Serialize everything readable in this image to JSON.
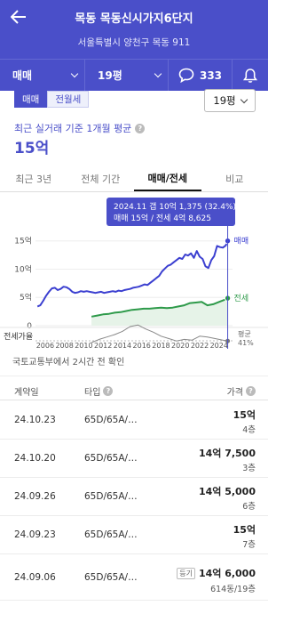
{
  "header": {
    "title": "목동 목동신시가지6단지",
    "address": "서울특별시 양천구 목동 911",
    "filter_type": "매매",
    "filter_size": "19평",
    "comment_count": "333"
  },
  "deal_tabs": [
    "매매",
    "전월세"
  ],
  "size_select": "19평",
  "average": {
    "label": "최근 실거래 기준 1개월 평균",
    "value": "15억"
  },
  "period_tabs": [
    "최근 3년",
    "전체 기간",
    "매매/전세",
    "비교"
  ],
  "chart_data": {
    "type": "line",
    "tooltip": {
      "line1": "2024.11  갭 10억 1,375 (32.4%)",
      "line2": "매매 15억 / 전세 4억 8,625"
    },
    "y_ticks": [
      "15억",
      "10억",
      "5억",
      "0"
    ],
    "ylim": [
      0,
      17
    ],
    "x_ticks": [
      "2006",
      "2008",
      "2010",
      "2012",
      "2014",
      "2016",
      "2018",
      "2020",
      "2022",
      "2024"
    ],
    "xlim": [
      2005.0,
      2025.4
    ],
    "ratio_axis_label": "전세가율",
    "ratio_end_label": "평균",
    "ratio_end_value": "41%",
    "series": [
      {
        "name": "매매",
        "color": "#3b3fd0",
        "x": [
          2005.2,
          2005.5,
          2005.8,
          2006.1,
          2006.4,
          2006.7,
          2007.0,
          2007.3,
          2007.6,
          2007.9,
          2008.2,
          2008.5,
          2008.8,
          2009.1,
          2009.4,
          2009.7,
          2010.0,
          2010.3,
          2010.6,
          2010.9,
          2011.2,
          2011.5,
          2011.8,
          2012.1,
          2012.4,
          2012.7,
          2013.0,
          2013.3,
          2013.6,
          2013.9,
          2014.2,
          2014.5,
          2014.8,
          2015.1,
          2015.4,
          2015.7,
          2016.0,
          2016.3,
          2016.6,
          2016.9,
          2017.2,
          2017.5,
          2017.8,
          2018.1,
          2018.4,
          2018.7,
          2019.0,
          2019.3,
          2019.6,
          2019.9,
          2020.2,
          2020.5,
          2020.8,
          2021.1,
          2021.4,
          2021.7,
          2022.0,
          2022.3,
          2022.6,
          2022.9,
          2023.2,
          2023.5,
          2023.8,
          2024.1,
          2024.4,
          2024.7,
          2024.9
        ],
        "values": [
          3.4,
          3.6,
          4.4,
          5.3,
          6.0,
          6.6,
          6.7,
          6.3,
          6.5,
          6.9,
          6.8,
          6.5,
          6.0,
          5.8,
          5.9,
          6.1,
          6.0,
          6.1,
          6.0,
          5.9,
          5.8,
          5.9,
          6.0,
          5.8,
          5.9,
          6.0,
          6.1,
          6.0,
          6.2,
          6.1,
          6.3,
          6.4,
          6.5,
          6.7,
          6.8,
          6.9,
          7.1,
          7.3,
          7.2,
          7.6,
          8.0,
          8.4,
          8.8,
          9.6,
          10.1,
          10.6,
          10.8,
          11.2,
          11.6,
          12.0,
          11.8,
          12.6,
          12.4,
          12.8,
          12.0,
          13.2,
          12.2,
          11.8,
          10.5,
          10.2,
          11.6,
          12.3,
          14.1,
          13.9,
          13.8,
          14.2,
          15.0
        ]
      },
      {
        "name": "전세",
        "color": "#2e9a4a",
        "x": [
          2010.8,
          2011.4,
          2012.0,
          2012.6,
          2013.2,
          2013.8,
          2014.4,
          2015.0,
          2015.6,
          2016.2,
          2016.8,
          2017.4,
          2018.0,
          2018.6,
          2019.2,
          2019.8,
          2020.4,
          2021.0,
          2021.6,
          2022.2,
          2022.8,
          2023.4,
          2024.0,
          2024.6,
          2024.9
        ],
        "values": [
          1.6,
          1.8,
          2.0,
          2.1,
          2.3,
          2.4,
          2.6,
          2.8,
          2.9,
          3.0,
          3.0,
          3.1,
          3.2,
          3.1,
          3.2,
          3.4,
          3.6,
          4.0,
          4.1,
          4.2,
          3.6,
          3.8,
          4.2,
          4.6,
          4.86
        ]
      },
      {
        "name": "전세가율",
        "color": "#888888",
        "x": [
          2010.8,
          2011.6,
          2012.4,
          2013.2,
          2014.0,
          2014.8,
          2015.6,
          2016.4,
          2017.2,
          2018.0,
          2018.8,
          2019.6,
          2020.4,
          2021.2,
          2022.0,
          2022.8,
          2023.6,
          2024.4,
          2024.9
        ],
        "values": [
          30,
          34,
          37,
          40,
          44,
          50,
          52,
          47,
          43,
          38,
          35,
          32,
          34,
          33,
          38,
          37,
          35,
          33,
          32
        ]
      }
    ]
  },
  "notice": "국토교통부에서 2시간 전 확인",
  "table": {
    "headers": {
      "date": "계약일",
      "type": "타입",
      "price": "가격"
    },
    "rows": [
      {
        "date": "24.10.23",
        "type": "65D/65A/…",
        "price": "15억",
        "floor": "4층",
        "badge": ""
      },
      {
        "date": "24.10.20",
        "type": "65D/65A/…",
        "price": "14억 7,500",
        "floor": "3층",
        "badge": ""
      },
      {
        "date": "24.09.26",
        "type": "65D/65A/…",
        "price": "14억 5,000",
        "floor": "6층",
        "badge": ""
      },
      {
        "date": "24.09.23",
        "type": "65D/65A/…",
        "price": "15억",
        "floor": "7층",
        "badge": ""
      },
      {
        "date": "24.09.06",
        "type": "65D/65A/…",
        "price": "14억 6,000",
        "floor": "614동/19층",
        "badge": "등기"
      }
    ]
  }
}
